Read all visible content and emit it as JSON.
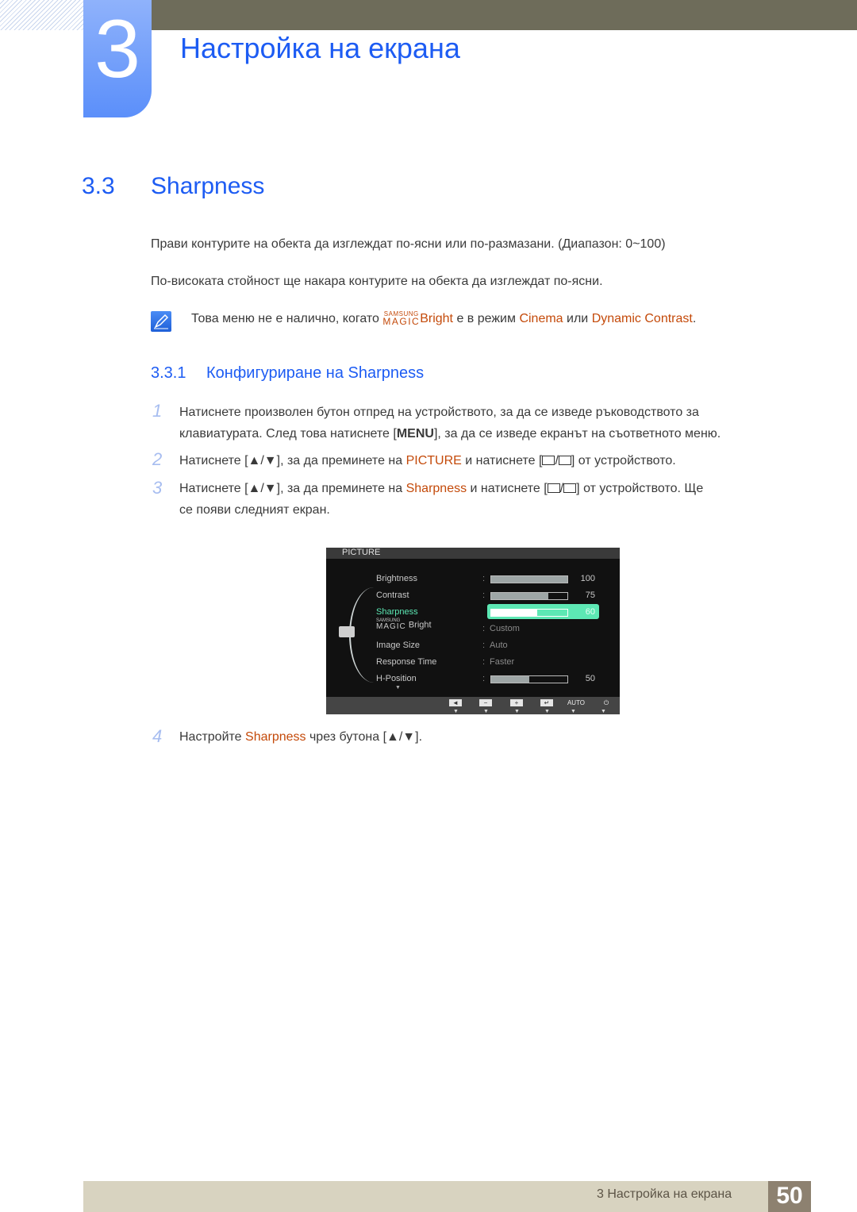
{
  "header": {
    "chapter_number": "3",
    "chapter_title": "Настройка на екрана"
  },
  "section": {
    "number": "3.3",
    "title": "Sharpness",
    "paragraph1": "Прави контурите на обекта да изглеждат по-ясни или по-размазани. (Диапазон: 0~100)",
    "paragraph2": "По-високата стойност ще накара контурите на обекта да изглеждат по-ясни."
  },
  "note": {
    "icon": "note-pencil-icon",
    "text_before": "Това меню не е налично, когато ",
    "magic_top": "SAMSUNG",
    "magic_bottom": "MAGIC",
    "bright": "Bright",
    "text_mid": " е в режим ",
    "cinema": "Cinema",
    "or": " или ",
    "dynamic_contrast": "Dynamic Contrast",
    "end": "."
  },
  "subsection": {
    "number": "3.3.1",
    "title": "Конфигуриране на Sharpness"
  },
  "steps": [
    {
      "num": "1",
      "line1": "Натиснете произволен бутон отпред на устройството, за да се изведе ръководството за",
      "line2_before": "клавиатурата. След това натиснете [",
      "key": "MENU",
      "line2_after": "], за да се изведе екранът на съответното меню."
    },
    {
      "num": "2",
      "before": "Натиснете [▲/▼], за да преминете на ",
      "highlight": "PICTURE",
      "mid": " и натиснете [",
      "after": "] от устройството."
    },
    {
      "num": "3",
      "before": "Натиснете [▲/▼], за да преминете на ",
      "highlight": "Sharpness",
      "mid": " и натиснете [",
      "after": "] от устройството. Ще",
      "line2": "се появи следният екран."
    },
    {
      "num": "4",
      "before": "Настройте ",
      "highlight": "Sharpness",
      "after": " чрез бутона [▲/▼]."
    }
  ],
  "osd": {
    "title": "PICTURE",
    "items": [
      {
        "label": "Brightness",
        "type": "bar",
        "value": 100
      },
      {
        "label": "Contrast",
        "type": "bar",
        "value": 75
      },
      {
        "label": "Sharpness",
        "type": "bar",
        "value": 60,
        "selected": true
      },
      {
        "label": "Bright",
        "label_prefix_top": "SAMSUNG",
        "label_prefix_bottom": "MAGIC",
        "type": "text",
        "value": "Custom"
      },
      {
        "label": "Image Size",
        "type": "text",
        "value": "Auto"
      },
      {
        "label": "Response Time",
        "type": "text",
        "value": "Faster"
      },
      {
        "label": "H-Position",
        "type": "bar",
        "value": 50
      }
    ],
    "footer_buttons": [
      "◄",
      "−",
      "+",
      "↵",
      "AUTO",
      "⏻"
    ],
    "colors": {
      "selected": "#5de8b4",
      "bar_fill": "#9ea6a6"
    }
  },
  "footer": {
    "chapter_label": "3 Настройка на екрана",
    "page_number": "50"
  },
  "colors": {
    "heading_blue": "#1d5cf3",
    "highlight_orange": "#c44a0a",
    "top_bar": "#6e6c5a",
    "footer_bar": "#d8d3c0",
    "page_box": "#8d8170"
  }
}
